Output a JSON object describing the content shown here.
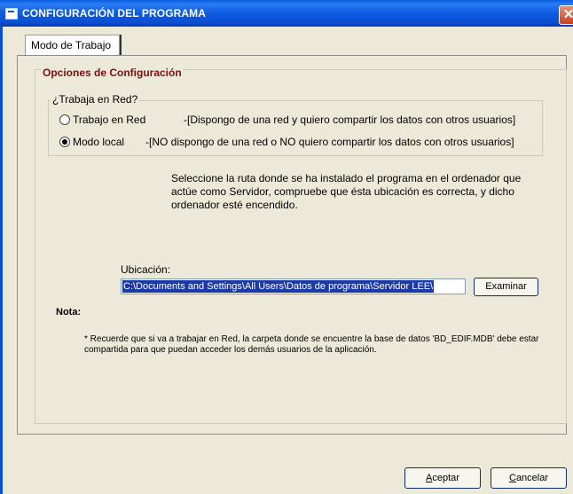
{
  "window": {
    "title": "CONFIGURACIÓN DEL PROGRAMA",
    "close_glyph": "✕"
  },
  "tabs": [
    {
      "label": "Modo de Trabajo"
    }
  ],
  "config": {
    "group_title": "Opciones de Configuración",
    "network": {
      "group_title": "¿Trabaja en Red?",
      "options": [
        {
          "label": "Trabajo en Red",
          "description": "-[Dispongo de una red y quiero compartir los datos con otros usuarios]",
          "selected": false
        },
        {
          "label": "Modo local",
          "description": "-[NO dispongo de una red o NO quiero compartir los datos con otros usuarios]",
          "selected": true
        }
      ]
    },
    "info_text": "Seleccione la ruta donde se ha instalado el programa en el ordenador que actúe como Servidor, compruebe que ésta ubicación es correcta, y dicho ordenador esté encendido.",
    "location": {
      "label": "Ubicación:",
      "value": "C:\\Documents and Settings\\All Users\\Datos de programa\\Servidor LEE\\",
      "browse_label": "Examinar"
    },
    "note": {
      "title": "Nota:",
      "text": "* Recuerde que si va a trabajar en Red, la carpeta donde se encuentre la base de datos 'BD_EDIF.MDB' debe estar compartida para que puedan acceder los demás usuarios de la aplicación."
    }
  },
  "footer": {
    "accept": {
      "first": "A",
      "rest": "ceptar"
    },
    "cancel": {
      "first": "C",
      "rest": "ancelar"
    }
  }
}
